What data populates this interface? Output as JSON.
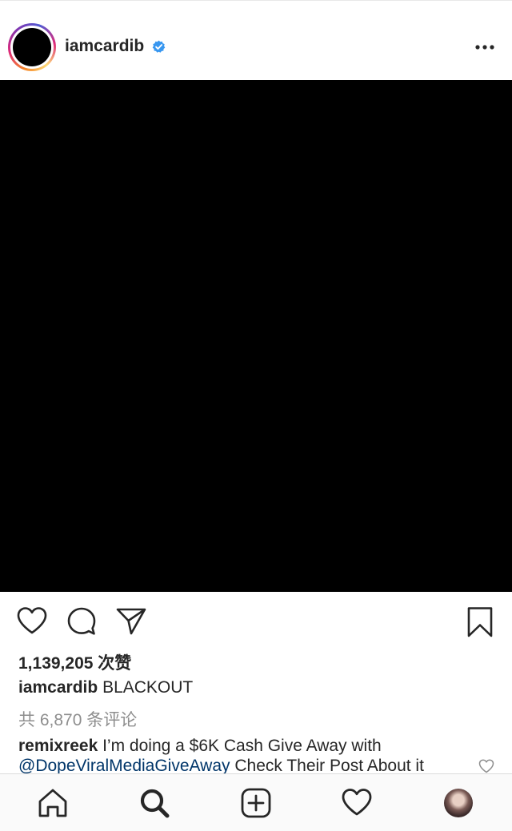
{
  "post": {
    "username": "iamcardib",
    "likes_text": "1,139,205 次赞",
    "caption_user": "iamcardib",
    "caption_text": "BLACKOUT",
    "view_comments_text": "共 6,870 条评论"
  },
  "comment": {
    "user": "remixreek",
    "text_before": "I’m doing a $6K Cash Give Away with",
    "mention": "@DopeViralMediaGiveAway",
    "text_after": "Check Their Post About it"
  },
  "icons": {
    "verified": "verified-badge-icon",
    "more": "more-options-icon",
    "like": "heart-icon",
    "comment": "comment-icon",
    "share": "paper-plane-icon",
    "save": "bookmark-icon",
    "tabs": [
      "home-icon",
      "search-icon",
      "add-post-icon",
      "activity-heart-icon",
      "profile-avatar"
    ]
  },
  "colors": {
    "text": "#262626",
    "muted": "#8e8e8e",
    "mention": "#003569",
    "verified": "#3897f0",
    "media_background": "#000000"
  }
}
